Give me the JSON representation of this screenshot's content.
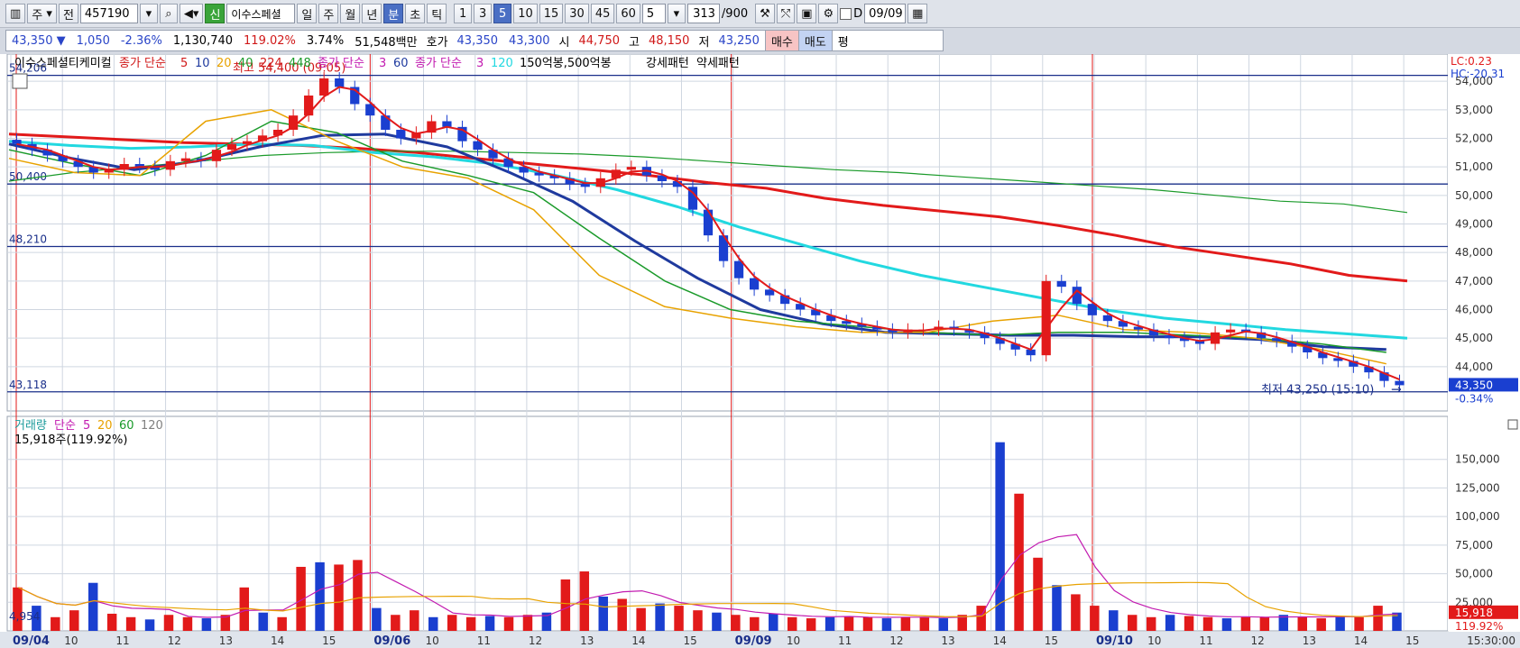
{
  "toolbar": {
    "market_label": "주",
    "prev_label": "전",
    "stock_code": "457190",
    "new_badge": "신",
    "stock_name": "이수스페셜",
    "periods": [
      "일",
      "주",
      "월",
      "년",
      "분",
      "초",
      "틱"
    ],
    "active_period": "분",
    "intervals": [
      "1",
      "3",
      "5",
      "10",
      "15",
      "30",
      "45",
      "60"
    ],
    "active_interval": "5",
    "interval_value": "5",
    "count_value": "313",
    "count_max": "/900",
    "d_label": "D",
    "date_value": "09/09"
  },
  "quote": {
    "price": "43,350",
    "change": "1,050",
    "change_pct": "-2.36%",
    "volume": "1,130,740",
    "volume_ratio": "119.02%",
    "turnover": "3.74%",
    "amount": "51,548백만",
    "hoga_label": "호가",
    "ask": "43,350",
    "bid": "43,300",
    "open_label": "시",
    "open": "44,750",
    "high_label": "고",
    "high": "48,150",
    "low_label": "저",
    "low": "43,250",
    "buy_label": "매수",
    "sell_label": "매도",
    "flat_label": "평"
  },
  "chart_data": {
    "type": "candlestick",
    "price_panel": {
      "legend": [
        {
          "text": "이수스페셜티케미컬",
          "color": "#000000"
        },
        {
          "text": "종가 단순",
          "color": "#d01818"
        },
        {
          "text": "5",
          "color": "#d01818"
        },
        {
          "text": "10",
          "color": "#1f3a9e"
        },
        {
          "text": "20",
          "color": "#e8a200"
        },
        {
          "text": "40",
          "color": "#1a9a2a"
        },
        {
          "text": "224",
          "color": "#d01818"
        },
        {
          "text": "448",
          "color": "#1a9a2a"
        },
        {
          "text": "종가 단순",
          "color": "#c21bb0"
        },
        {
          "text": "3",
          "color": "#c21bb0"
        },
        {
          "text": "60",
          "color": "#1f3a9e"
        },
        {
          "text": "종가 단순",
          "color": "#c21bb0"
        },
        {
          "text": "3",
          "color": "#c21bb0"
        },
        {
          "text": "120",
          "color": "#22d8e0"
        },
        {
          "text": "150억봉,500억봉",
          "color": "#000000"
        },
        {
          "text": "강세패턴",
          "color": "#000000"
        },
        {
          "text": "약세패턴",
          "color": "#000000"
        }
      ],
      "ylim": [
        42700,
        54700
      ],
      "yticks": [
        44000,
        45000,
        46000,
        47000,
        48000,
        49000,
        50000,
        51000,
        52000,
        53000,
        54000
      ],
      "ytick_labels": [
        "44,000",
        "45,000",
        "46,000",
        "47,000",
        "48,000",
        "49,000",
        "50,000",
        "51,000",
        "52,000",
        "53,000",
        "54,000"
      ],
      "lc_label": "LC:0.23",
      "hc_label": "HC:-20.31",
      "hlines": [
        {
          "value": 54206,
          "label": "54,206"
        },
        {
          "value": 50400,
          "label": "50,400"
        },
        {
          "value": 48210,
          "label": "48,210"
        },
        {
          "value": 43118,
          "label": "43,118"
        }
      ],
      "high_annotation": {
        "text": "최고 54,400 (09:05)",
        "value": 54400
      },
      "low_annotation": {
        "text": "최저 43,250 (15:10)",
        "value": 43250
      },
      "current_price": {
        "text": "43,350",
        "value": 43350
      },
      "current_pct": "-0.34%",
      "candles_close": [
        51800,
        51600,
        51400,
        51200,
        51000,
        50800,
        50900,
        51100,
        51000,
        50900,
        51200,
        51300,
        51200,
        51600,
        51800,
        51900,
        52100,
        52300,
        52800,
        53500,
        54100,
        53800,
        53200,
        52800,
        52300,
        52000,
        52200,
        52600,
        52400,
        51900,
        51600,
        51300,
        51000,
        50800,
        50700,
        50600,
        50400,
        50300,
        50600,
        50900,
        51000,
        50700,
        50500,
        50300,
        49500,
        48600,
        47700,
        47100,
        46700,
        46500,
        46200,
        46000,
        45800,
        45600,
        45500,
        45400,
        45300,
        45200,
        45300,
        45300,
        45400,
        45300,
        45200,
        45000,
        44800,
        44600,
        44400,
        47000,
        46800,
        46200,
        45800,
        45600,
        45400,
        45300,
        45100,
        45000,
        44900,
        44800,
        45200,
        45300,
        45200,
        45000,
        44900,
        44700,
        44500,
        44300,
        44200,
        44000,
        43800,
        43500,
        43350
      ],
      "ma_lines": [
        {
          "label": "224",
          "color": "#e21a1a",
          "width": 3,
          "values": [
            52150,
            52050,
            51950,
            51850,
            51800,
            51750,
            51650,
            51500,
            51300,
            51100,
            50900,
            50700,
            50450,
            50250,
            49900,
            49650,
            49450,
            49250,
            48950,
            48600,
            48200,
            47900,
            47600,
            47200,
            47000
          ]
        },
        {
          "label": "448",
          "color": "#1a9a2a",
          "width": 1.2,
          "values": [
            50500,
            50800,
            51000,
            51200,
            51400,
            51500,
            51550,
            51550,
            51500,
            51450,
            51350,
            51200,
            51050,
            50900,
            50800,
            50650,
            50500,
            50350,
            50200,
            50000,
            49800,
            49700,
            49400
          ]
        },
        {
          "label": "120",
          "color": "#22d8e0",
          "width": 3,
          "values": [
            51900,
            51750,
            51650,
            51700,
            51800,
            51750,
            51500,
            51350,
            51100,
            50700,
            50200,
            49600,
            48900,
            48300,
            47700,
            47200,
            46800,
            46400,
            46000,
            45700,
            45500,
            45300,
            45150,
            45000
          ]
        },
        {
          "label": "60",
          "color": "#1f3a9e",
          "width": 3,
          "values": [
            51800,
            51300,
            50900,
            51200,
            51700,
            52100,
            52150,
            51700,
            50800,
            49800,
            48400,
            47100,
            46000,
            45500,
            45200,
            45150,
            45100,
            45100,
            45050,
            45050,
            44950,
            44700,
            44600
          ]
        },
        {
          "label": "40",
          "color": "#1a9a2a",
          "width": 1.5,
          "values": [
            51600,
            51100,
            50700,
            51400,
            52600,
            52200,
            51200,
            50700,
            50100,
            48500,
            47000,
            46000,
            45600,
            45400,
            45200,
            45100,
            45200,
            45200,
            45100,
            45000,
            44800,
            44500
          ]
        },
        {
          "label": "20",
          "color": "#e8a200",
          "width": 1.5,
          "values": [
            51300,
            50800,
            50700,
            52600,
            53000,
            51900,
            51000,
            50600,
            49500,
            47200,
            46100,
            45700,
            45400,
            45200,
            45200,
            45600,
            45800,
            45300,
            45200,
            45000,
            44600,
            44100
          ]
        }
      ]
    },
    "volume_panel": {
      "legend": [
        {
          "text": "거래량",
          "color": "#1a9a9a"
        },
        {
          "text": "단순",
          "color": "#c21bb0"
        },
        {
          "text": "5",
          "color": "#c21bb0"
        },
        {
          "text": "20",
          "color": "#e8a200"
        },
        {
          "text": "60",
          "color": "#1a9a2a"
        },
        {
          "text": "120",
          "color": "#808080"
        }
      ],
      "current_label": "15,918주(119.92%)",
      "ylim": [
        0,
        175000
      ],
      "yticks": [
        25000,
        50000,
        75000,
        100000,
        125000,
        150000
      ],
      "ytick_labels": [
        "25,000",
        "50,000",
        "75,000",
        "100,000",
        "125,000",
        "150,000"
      ],
      "current_value": {
        "text": "15,918",
        "value": 15918
      },
      "current_pct": "119.92%",
      "left_value": "4,954",
      "volumes": [
        38000,
        22000,
        12000,
        18000,
        42000,
        15000,
        12000,
        10000,
        14000,
        12000,
        11000,
        14000,
        38000,
        16000,
        12000,
        56000,
        60000,
        58000,
        62000,
        20000,
        14000,
        18000,
        12000,
        14000,
        12000,
        13000,
        12000,
        14000,
        16000,
        45000,
        52000,
        30000,
        28000,
        20000,
        24000,
        22000,
        18000,
        16000,
        14000,
        12000,
        15000,
        12000,
        11000,
        12000,
        13000,
        12000,
        11000,
        12000,
        12000,
        11000,
        14000,
        22000,
        165000,
        120000,
        64000,
        40000,
        32000,
        22000,
        18000,
        14000,
        12000,
        14000,
        13000,
        12000,
        11000,
        12000,
        12000,
        14000,
        12000,
        11000,
        13000,
        12000,
        22000,
        16000
      ]
    },
    "x_axis": {
      "ticks": [
        {
          "text": "09/04",
          "bold": true
        },
        {
          "text": "10",
          "bold": false
        },
        {
          "text": "11",
          "bold": false
        },
        {
          "text": "12",
          "bold": false
        },
        {
          "text": "13",
          "bold": false
        },
        {
          "text": "14",
          "bold": false
        },
        {
          "text": "15",
          "bold": false
        },
        {
          "text": "09/06",
          "bold": true
        },
        {
          "text": "10",
          "bold": false
        },
        {
          "text": "11",
          "bold": false
        },
        {
          "text": "12",
          "bold": false
        },
        {
          "text": "13",
          "bold": false
        },
        {
          "text": "14",
          "bold": false
        },
        {
          "text": "15",
          "bold": false
        },
        {
          "text": "09/09",
          "bold": true
        },
        {
          "text": "10",
          "bold": false
        },
        {
          "text": "11",
          "bold": false
        },
        {
          "text": "12",
          "bold": false
        },
        {
          "text": "13",
          "bold": false
        },
        {
          "text": "14",
          "bold": false
        },
        {
          "text": "15",
          "bold": false
        },
        {
          "text": "09/10",
          "bold": true
        },
        {
          "text": "10",
          "bold": false
        },
        {
          "text": "11",
          "bold": false
        },
        {
          "text": "12",
          "bold": false
        },
        {
          "text": "13",
          "bold": false
        },
        {
          "text": "14",
          "bold": false
        },
        {
          "text": "15",
          "bold": false
        }
      ],
      "time_label": "15:30:00"
    },
    "colors": {
      "up": "#e21a1a",
      "down": "#1a3fd0",
      "grid": "#cfd6e0",
      "axis_bg": "#ffffff"
    }
  }
}
